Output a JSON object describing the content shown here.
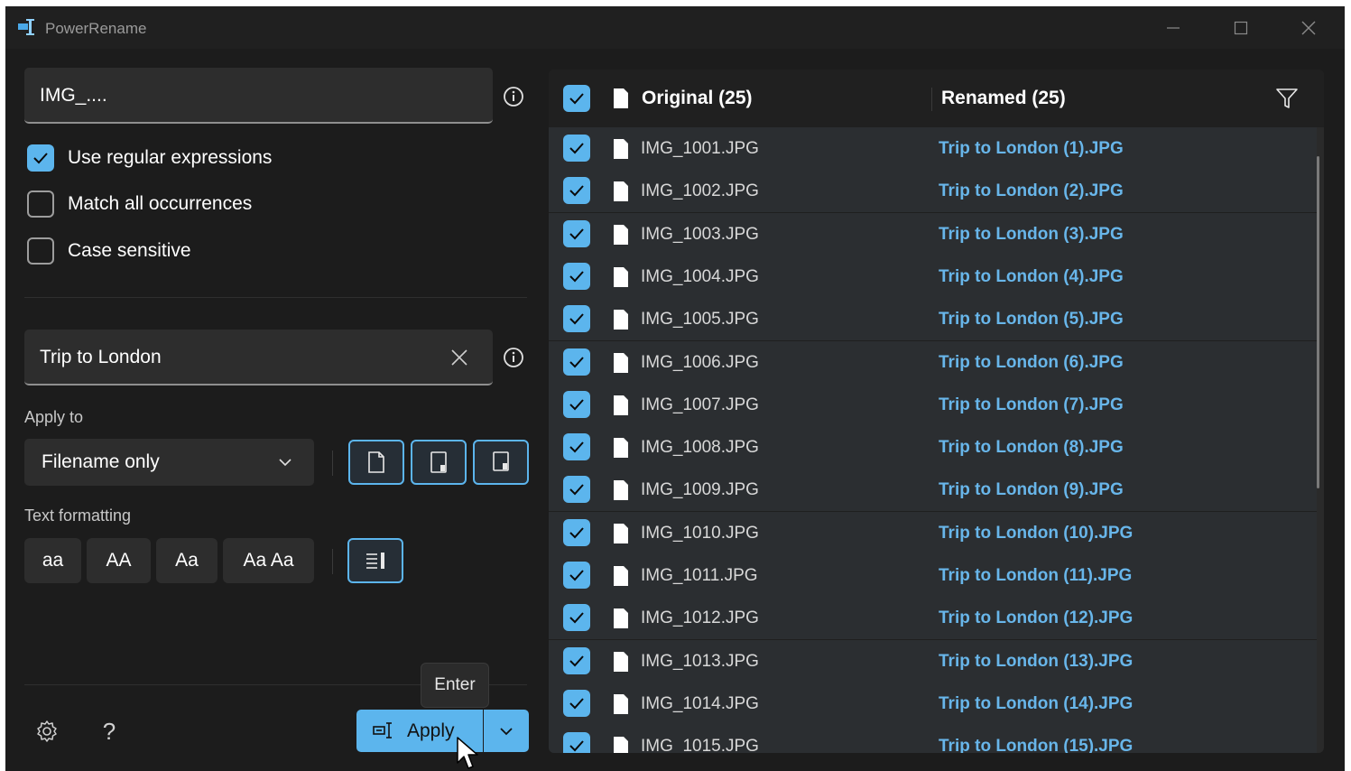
{
  "window": {
    "title": "PowerRename"
  },
  "search": {
    "value": "IMG_...."
  },
  "options": [
    {
      "label": "Use regular expressions",
      "checked": true
    },
    {
      "label": "Match all occurrences",
      "checked": false
    },
    {
      "label": "Case sensitive",
      "checked": false
    }
  ],
  "replace": {
    "value": "Trip to London"
  },
  "apply_to": {
    "label": "Apply to",
    "selected": "Filename only"
  },
  "text_formatting": {
    "label": "Text formatting",
    "buttons": [
      "aa",
      "AA",
      "Aa",
      "Aa Aa"
    ]
  },
  "apply_button": {
    "label": "Apply",
    "tooltip": "Enter"
  },
  "help": {
    "label": "?"
  },
  "list": {
    "original_header": "Original (25)",
    "renamed_header": "Renamed (25)",
    "rows": [
      {
        "original": "IMG_1001.JPG",
        "renamed": "Trip to London (1).JPG"
      },
      {
        "original": "IMG_1002.JPG",
        "renamed": "Trip to London (2).JPG"
      },
      {
        "original": "IMG_1003.JPG",
        "renamed": "Trip to London (3).JPG"
      },
      {
        "original": "IMG_1004.JPG",
        "renamed": "Trip to London (4).JPG"
      },
      {
        "original": "IMG_1005.JPG",
        "renamed": "Trip to London (5).JPG"
      },
      {
        "original": "IMG_1006.JPG",
        "renamed": "Trip to London (6).JPG"
      },
      {
        "original": "IMG_1007.JPG",
        "renamed": "Trip to London (7).JPG"
      },
      {
        "original": "IMG_1008.JPG",
        "renamed": "Trip to London (8).JPG"
      },
      {
        "original": "IMG_1009.JPG",
        "renamed": "Trip to London (9).JPG"
      },
      {
        "original": "IMG_1010.JPG",
        "renamed": "Trip to London (10).JPG"
      },
      {
        "original": "IMG_1011.JPG",
        "renamed": "Trip to London (11).JPG"
      },
      {
        "original": "IMG_1012.JPG",
        "renamed": "Trip to London (12).JPG"
      },
      {
        "original": "IMG_1013.JPG",
        "renamed": "Trip to London (13).JPG"
      },
      {
        "original": "IMG_1014.JPG",
        "renamed": "Trip to London (14).JPG"
      },
      {
        "original": "IMG_1015.JPG",
        "renamed": "Trip to London (15).JPG"
      }
    ]
  },
  "colors": {
    "accent": "#5cb5ed",
    "renamed_text": "#68b6ea",
    "background": "#1c1c1c"
  }
}
